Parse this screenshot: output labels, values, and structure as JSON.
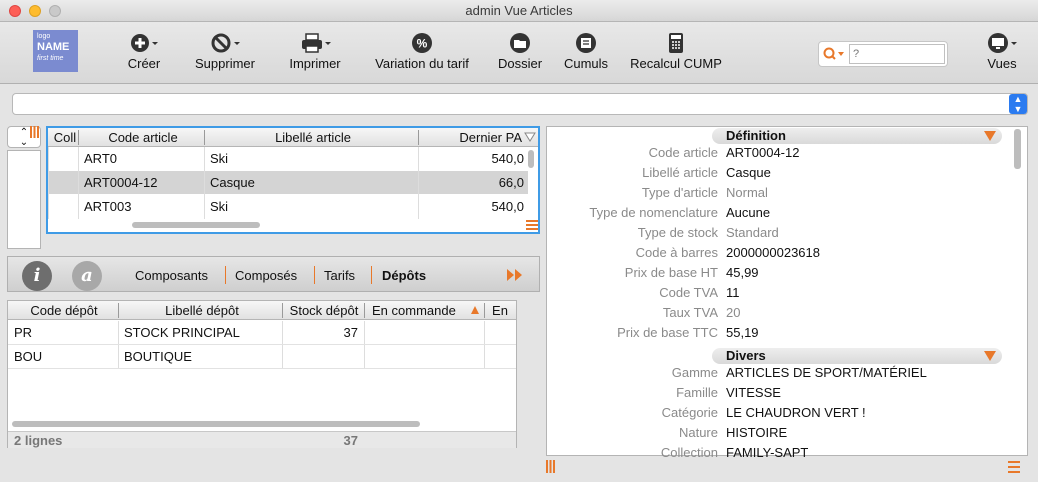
{
  "window": {
    "title": "admin Vue Articles"
  },
  "logo": {
    "small": "logo",
    "name": "NAME",
    "sub": "first time"
  },
  "toolbar": {
    "creer": "Créer",
    "supprimer": "Supprimer",
    "imprimer": "Imprimer",
    "variation": "Variation du tarif",
    "dossier": "Dossier",
    "cumuls": "Cumuls",
    "recalcul": "Recalcul CUMP",
    "vues": "Vues"
  },
  "search": {
    "placeholder": "?"
  },
  "articles_table": {
    "columns": [
      "Coll",
      "Code article",
      "Libellé article",
      "Dernier PA"
    ],
    "rows": [
      {
        "code": "ART0",
        "libelle": "Ski",
        "pa": "540,0"
      },
      {
        "code": "ART0004-12",
        "libelle": "Casque",
        "pa": "66,0"
      },
      {
        "code": "ART003",
        "libelle": "Ski",
        "pa": "540,0"
      }
    ]
  },
  "tabs": {
    "info_icon": "i",
    "at_icon": "a",
    "items": [
      "Composants",
      "Composés",
      "Tarifs",
      "Dépôts"
    ],
    "active": "Dépôts"
  },
  "depots_table": {
    "columns": [
      "Code dépôt",
      "Libellé dépôt",
      "Stock dépôt",
      "En commande",
      "En"
    ],
    "rows": [
      {
        "code": "PR",
        "libelle": "STOCK PRINCIPAL",
        "stock": "37"
      },
      {
        "code": "BOU",
        "libelle": "BOUTIQUE",
        "stock": ""
      }
    ],
    "footer_count": "2 lignes",
    "footer_total": "37"
  },
  "detail": {
    "definition_title": "Définition",
    "definition": [
      {
        "label": "Code article",
        "value": "ART0004-12",
        "muted": false
      },
      {
        "label": "Libellé article",
        "value": "Casque",
        "muted": false
      },
      {
        "label": "Type d'article",
        "value": "Normal",
        "muted": true
      },
      {
        "label": "Type de nomenclature",
        "value": "Aucune",
        "muted": false
      },
      {
        "label": "Type de stock",
        "value": "Standard",
        "muted": true
      },
      {
        "label": "Code à barres",
        "value": "2000000023618",
        "muted": false
      },
      {
        "label": "Prix de base HT",
        "value": "45,99",
        "muted": false
      },
      {
        "label": "Code TVA",
        "value": "11",
        "muted": false
      },
      {
        "label": "Taux TVA",
        "value": "20",
        "muted": true
      },
      {
        "label": "Prix de base TTC",
        "value": "55,19",
        "muted": false
      }
    ],
    "divers_title": "Divers",
    "divers": [
      {
        "label": "Gamme",
        "value": "ARTICLES DE SPORT/MATÉRIEL"
      },
      {
        "label": "Famille",
        "value": "VITESSE"
      },
      {
        "label": "Catégorie",
        "value": "LE CHAUDRON VERT !"
      },
      {
        "label": "Nature",
        "value": "HISTOIRE"
      },
      {
        "label": "Collection",
        "value": "FAMILY-SAPT"
      }
    ]
  },
  "colors": {
    "accent": "#e8782a",
    "selection": "#d4d4d4",
    "focus": "#3f9be6"
  }
}
